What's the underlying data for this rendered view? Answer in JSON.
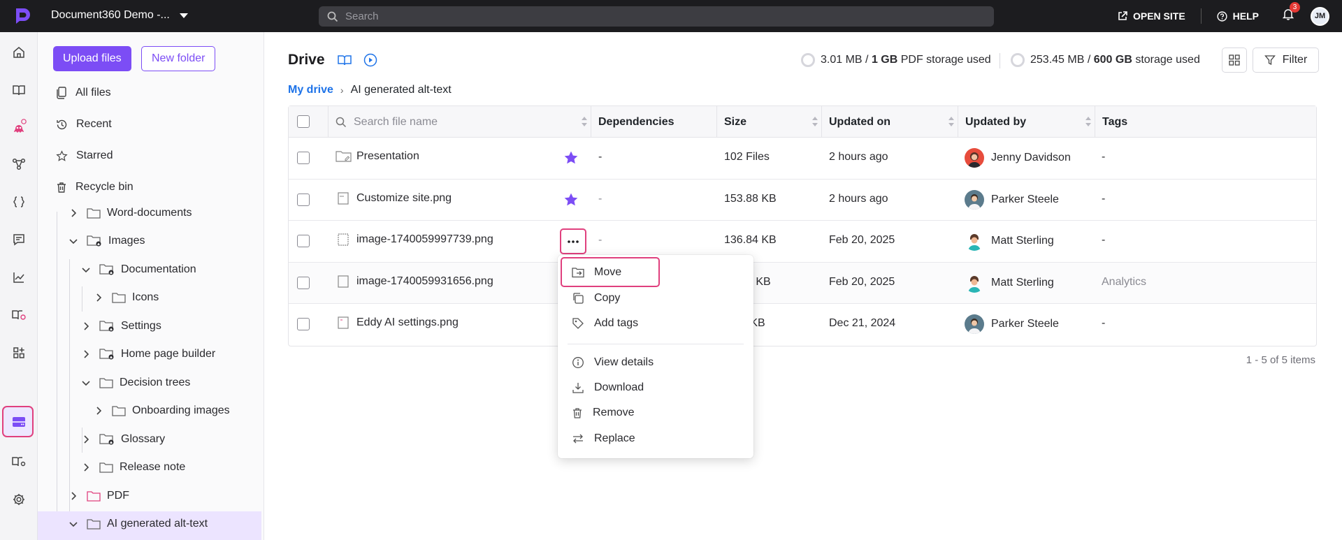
{
  "topbar": {
    "project_name": "Document360 Demo -...",
    "search_placeholder": "Search",
    "open_site": "OPEN SITE",
    "help": "HELP",
    "notification_count": "3",
    "user_initials": "JM"
  },
  "rail": {
    "icons": [
      "home-icon",
      "book-icon",
      "eddy-ai-icon",
      "workflow-icon",
      "api-icon",
      "feedback-icon",
      "analytics-icon",
      "widget-icon",
      "apps-icon",
      "drive-icon",
      "kb-settings-icon",
      "settings-icon"
    ]
  },
  "panel": {
    "upload_label": "Upload files",
    "new_folder_label": "New folder",
    "nav": [
      {
        "label": "All files",
        "icon": "all-files-icon"
      },
      {
        "label": "Recent",
        "icon": "history-icon"
      },
      {
        "label": "Starred",
        "icon": "star-icon"
      },
      {
        "label": "Recycle bin",
        "icon": "trash-icon"
      }
    ],
    "tree": [
      {
        "label": "Word-documents",
        "state": "collapsed"
      },
      {
        "label": "Images",
        "state": "expanded"
      },
      {
        "label": "Documentation",
        "state": "expanded"
      },
      {
        "label": "Icons",
        "state": "collapsed"
      },
      {
        "label": "Settings",
        "state": "collapsed"
      },
      {
        "label": "Home page builder",
        "state": "collapsed"
      },
      {
        "label": "Decision trees",
        "state": "expanded"
      },
      {
        "label": "Onboarding images",
        "state": "collapsed"
      },
      {
        "label": "Glossary",
        "state": "collapsed"
      },
      {
        "label": "Release note",
        "state": "collapsed"
      },
      {
        "label": "PDF",
        "state": "collapsed"
      },
      {
        "label": "AI generated alt-text",
        "state": "expanded",
        "selected": true
      }
    ]
  },
  "main": {
    "title": "Drive",
    "storage_pdf_used": "3.01 MB",
    "storage_pdf_sep": " / ",
    "storage_pdf_total": "1 GB",
    "storage_pdf_label": "PDF storage used",
    "storage_used": "253.45 MB",
    "storage_sep": " / ",
    "storage_total": "600 GB",
    "storage_label": "storage used",
    "filter_label": "Filter",
    "breadcrumb_root": "My drive",
    "breadcrumb_current": "AI generated alt-text",
    "pagination": "1 - 5 of 5 items"
  },
  "table": {
    "search_placeholder": "Search file name",
    "columns": {
      "dependencies": "Dependencies",
      "size": "Size",
      "updated_on": "Updated on",
      "updated_by": "Updated by",
      "tags": "Tags"
    },
    "rows": [
      {
        "name": "Presentation",
        "type": "folder",
        "starred": true,
        "dependencies": "-",
        "size": "102 Files",
        "updated_on": "2 hours ago",
        "updated_by": "Jenny Davidson",
        "tags": "-"
      },
      {
        "name": "Customize site.png",
        "type": "image",
        "starred": true,
        "dependencies": "-",
        "size": "153.88 KB",
        "updated_on": "2 hours ago",
        "updated_by": "Parker Steele",
        "tags": "-"
      },
      {
        "name": "image-1740059997739.png",
        "type": "image",
        "starred": false,
        "dependencies": "-",
        "size": "136.84 KB",
        "updated_on": "Feb 20, 2025",
        "updated_by": "Matt Sterling",
        "tags": "-"
      },
      {
        "name": "image-1740059931656.png",
        "type": "image",
        "starred": false,
        "dependencies": "",
        "size": "0 KB",
        "updated_on": "Feb 20, 2025",
        "updated_by": "Matt Sterling",
        "tags": "Analytics"
      },
      {
        "name": "Eddy AI settings.png",
        "type": "image",
        "starred": false,
        "dependencies": "",
        "size": "0 KB",
        "updated_on": "Dec 21, 2024",
        "updated_by": "Parker Steele",
        "tags": "-"
      }
    ]
  },
  "context_menu": {
    "items": [
      {
        "label": "Move",
        "icon": "move-icon"
      },
      {
        "label": "Copy",
        "icon": "copy-icon"
      },
      {
        "label": "Add tags",
        "icon": "tag-icon"
      },
      {
        "label": "View details",
        "icon": "info-icon"
      },
      {
        "label": "Download",
        "icon": "download-icon"
      },
      {
        "label": "Remove",
        "icon": "trash-icon"
      },
      {
        "label": "Replace",
        "icon": "replace-icon"
      }
    ]
  },
  "colors": {
    "brand": "#7c4df5",
    "highlight": "#e0407e",
    "star": "#7c4df5",
    "link": "#1e73e8"
  }
}
